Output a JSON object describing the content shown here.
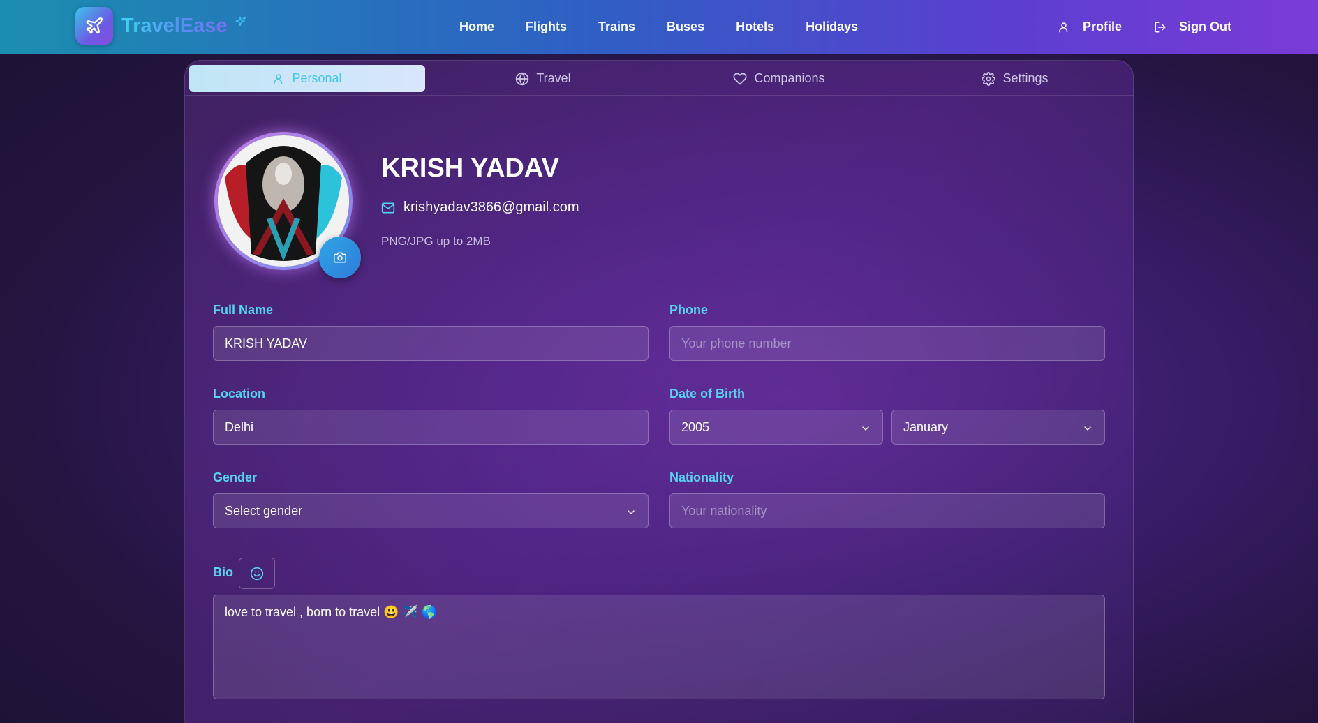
{
  "brand": {
    "name": "TravelEase",
    "logo_icon": "plane-icon"
  },
  "nav": {
    "links": [
      "Home",
      "Flights",
      "Trains",
      "Buses",
      "Hotels",
      "Holidays"
    ],
    "profile_label": "Profile",
    "signout_label": "Sign Out"
  },
  "tabs": [
    {
      "label": "Personal",
      "icon": "user-icon",
      "active": true
    },
    {
      "label": "Travel",
      "icon": "globe-icon",
      "active": false
    },
    {
      "label": "Companions",
      "icon": "heart-icon",
      "active": false
    },
    {
      "label": "Settings",
      "icon": "gear-icon",
      "active": false
    }
  ],
  "profile": {
    "name": "KRISH YADAV",
    "email": "krishyadav3866@gmail.com",
    "upload_hint": "PNG/JPG up to 2MB"
  },
  "form": {
    "full_name": {
      "label": "Full Name",
      "value": "KRISH YADAV"
    },
    "phone": {
      "label": "Phone",
      "placeholder": "Your phone number"
    },
    "location": {
      "label": "Location",
      "value": "Delhi"
    },
    "dob": {
      "label": "Date of Birth",
      "year": "2005",
      "month": "January"
    },
    "gender": {
      "label": "Gender",
      "value": "Select gender"
    },
    "nationality": {
      "label": "Nationality",
      "placeholder": "Your nationality"
    },
    "bio": {
      "label": "Bio",
      "value": "love to travel , born to travel 😃 ✈️ 🌎"
    }
  },
  "colors": {
    "accent": "#56d3f0",
    "active_tab_bg": "#d9e6fb",
    "camera_button": "#2f8ae0"
  }
}
